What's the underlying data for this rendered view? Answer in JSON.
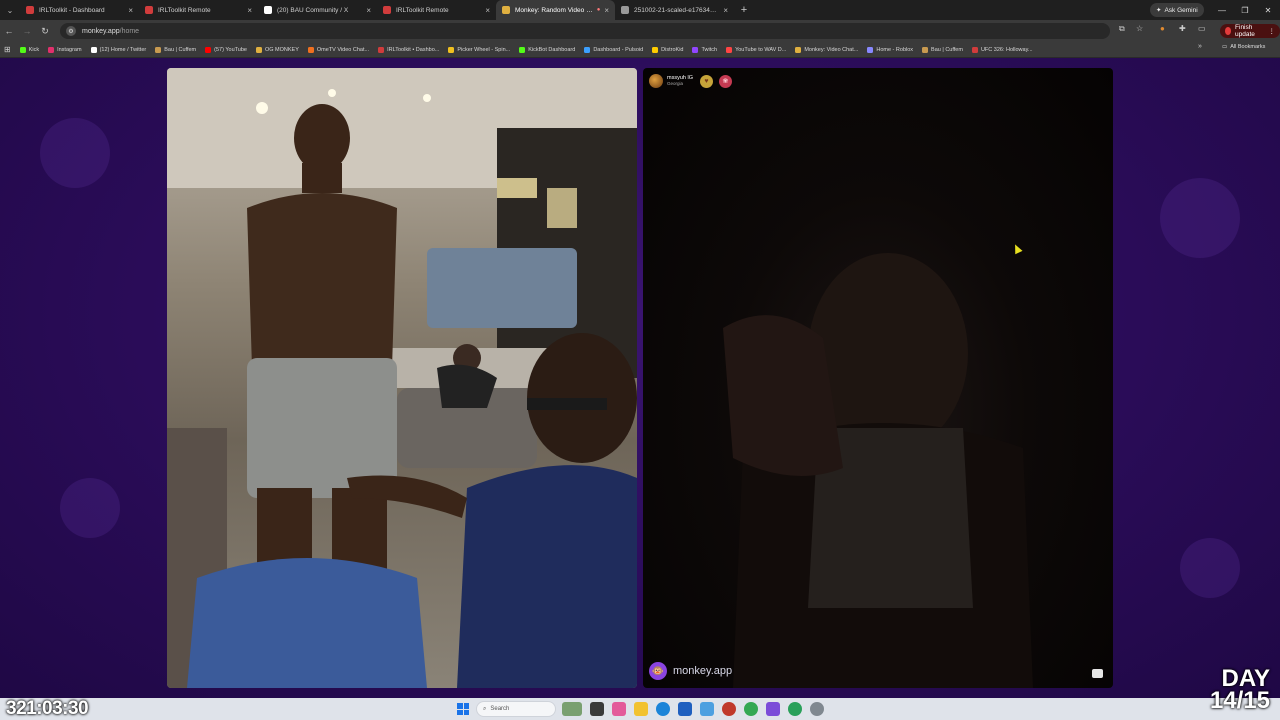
{
  "browser": {
    "tabs": [
      {
        "title": "IRLToolkit - Dashboard",
        "color": "#d13c3c",
        "active": false
      },
      {
        "title": "IRLToolkit Remote",
        "color": "#d13c3c",
        "active": false
      },
      {
        "title": "(20) BAU Community / X",
        "color": "#ffffff",
        "active": false
      },
      {
        "title": "IRLToolkit Remote",
        "color": "#d13c3c",
        "active": false
      },
      {
        "title": "Monkey: Random Video Ch",
        "color": "#e0b040",
        "active": true
      },
      {
        "title": "251002-21-scaled-e17634987",
        "color": "#9a9a9a",
        "active": false
      }
    ],
    "tab_close_glyph": "×",
    "new_tab_glyph": "+",
    "ask_gemini_label": "Ask Gemini",
    "address": {
      "host": "monkey.app",
      "path": "/home"
    },
    "finish_update_label": "Finish update",
    "bookmarks": [
      {
        "label": "Kick",
        "color": "#53fc18"
      },
      {
        "label": "Instagram",
        "color": "#e1306c"
      },
      {
        "label": "(12) Home / Twitter",
        "color": "#ffffff"
      },
      {
        "label": "Bau | Cuffem",
        "color": "#c89a50"
      },
      {
        "label": "(57) YouTube",
        "color": "#ff0000"
      },
      {
        "label": "OG MONKEY",
        "color": "#e0b040"
      },
      {
        "label": "OmeTV Video Chat...",
        "color": "#f07020"
      },
      {
        "label": "IRLToolkit • Dashbo...",
        "color": "#d13c3c"
      },
      {
        "label": "Picker Wheel - Spin...",
        "color": "#f0c020"
      },
      {
        "label": "KickBot Dashboard",
        "color": "#53fc18"
      },
      {
        "label": "Dashboard - Pulsoid",
        "color": "#3ca0ff"
      },
      {
        "label": "DistroKid",
        "color": "#ffcc00"
      },
      {
        "label": "Twitch",
        "color": "#9146ff"
      },
      {
        "label": "YouTube to WAV D...",
        "color": "#ff4444"
      },
      {
        "label": "Monkey: Video Chat...",
        "color": "#e0b040"
      },
      {
        "label": "Home - Roblox",
        "color": "#8888ff"
      },
      {
        "label": "Bau | Cuffem",
        "color": "#c89a50"
      },
      {
        "label": "UFC 326: Holloway...",
        "color": "#d13c3c"
      }
    ],
    "all_bookmarks_label": "All Bookmarks"
  },
  "chat": {
    "peer_name": "mssyuh lG",
    "peer_location": "Georgia",
    "badge_heart": "♥",
    "badge_flower": "❀"
  },
  "brand": {
    "name": "monkey.app",
    "logo_glyph": "🐵"
  },
  "taskbar": {
    "search_placeholder": "Search"
  },
  "overlay": {
    "timer": "321:03:30",
    "day_label": "DAY",
    "day_count": "14/15"
  },
  "colors": {
    "accent": "#8a44e0",
    "page_bg": "#2a0c58"
  }
}
